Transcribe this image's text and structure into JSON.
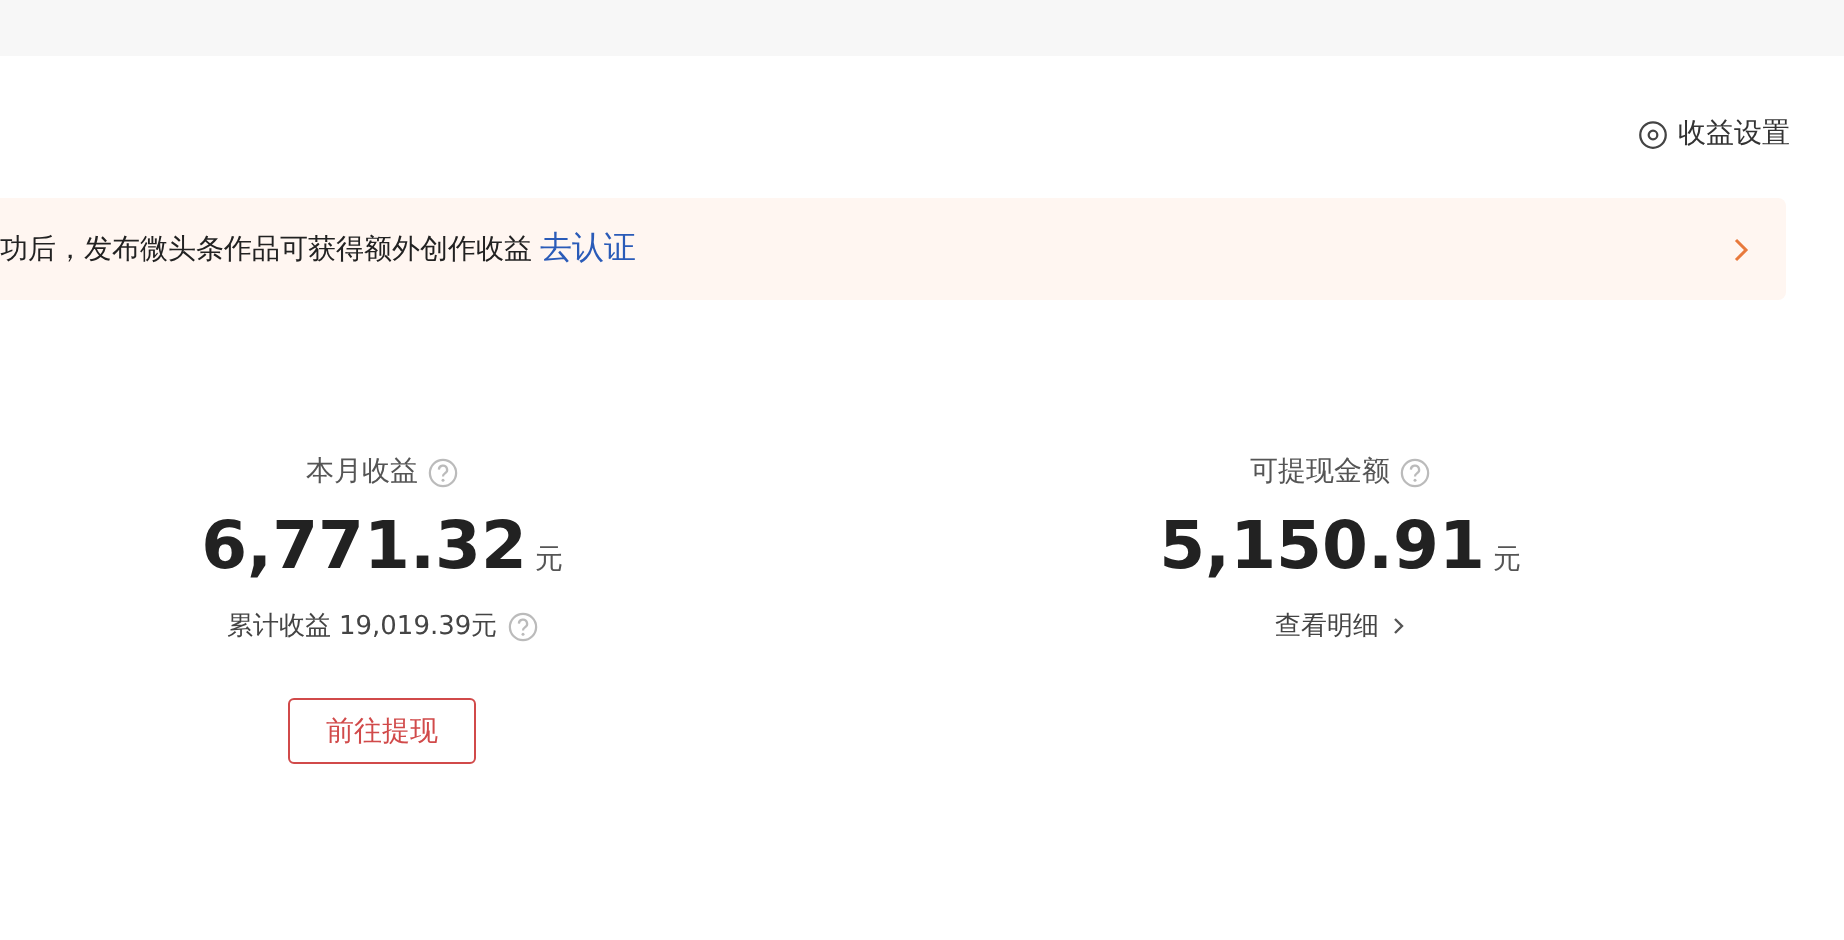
{
  "settings_link": {
    "label": "收益设置"
  },
  "notice_banner": {
    "text": "功后，发布微头条作品可获得额外创作收益",
    "link": "去认证"
  },
  "stats": [
    {
      "title": "本月收益",
      "value": "6,771.32",
      "unit": "元",
      "kind": "total",
      "sub_text": "累计收益 19,019.39元",
      "button": "前往提现"
    },
    {
      "title": "可提现金额",
      "value": "5,150.91",
      "unit": "元",
      "kind": "link",
      "sub_text": "查看明细"
    }
  ]
}
